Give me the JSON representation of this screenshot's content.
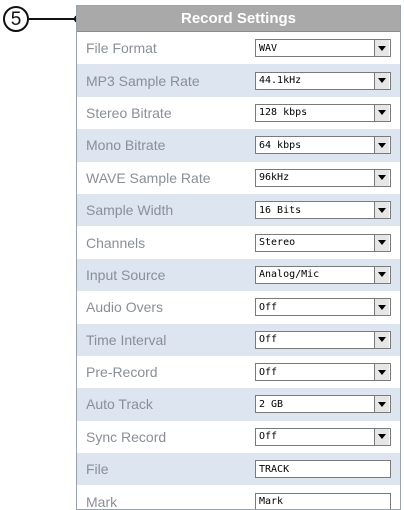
{
  "callout": {
    "number": "5"
  },
  "header": {
    "title": "Record Settings"
  },
  "rows": [
    {
      "label": "File Format",
      "value": "WAV",
      "control": "select"
    },
    {
      "label": "MP3 Sample Rate",
      "value": "44.1kHz",
      "control": "select"
    },
    {
      "label": "Stereo Bitrate",
      "value": "128 kbps",
      "control": "select"
    },
    {
      "label": "Mono Bitrate",
      "value": "64 kbps",
      "control": "select"
    },
    {
      "label": "WAVE Sample Rate",
      "value": "96kHz",
      "control": "select"
    },
    {
      "label": "Sample Width",
      "value": "16 Bits",
      "control": "select"
    },
    {
      "label": "Channels",
      "value": "Stereo",
      "control": "select"
    },
    {
      "label": "Input Source",
      "value": "Analog/Mic",
      "control": "select"
    },
    {
      "label": "Audio Overs",
      "value": "Off",
      "control": "select"
    },
    {
      "label": "Time Interval",
      "value": "Off",
      "control": "select"
    },
    {
      "label": "Pre-Record",
      "value": "Off",
      "control": "select"
    },
    {
      "label": "Auto Track",
      "value": "2 GB",
      "control": "select"
    },
    {
      "label": "Sync Record",
      "value": "Off",
      "control": "select"
    },
    {
      "label": "File",
      "value": "TRACK",
      "control": "text"
    },
    {
      "label": "Mark",
      "value": "Mark",
      "control": "text"
    }
  ],
  "colors": {
    "header_bg": "#a9a9a9",
    "row_alt_bg": "#dde5f1",
    "label_text": "#8a8f97"
  }
}
